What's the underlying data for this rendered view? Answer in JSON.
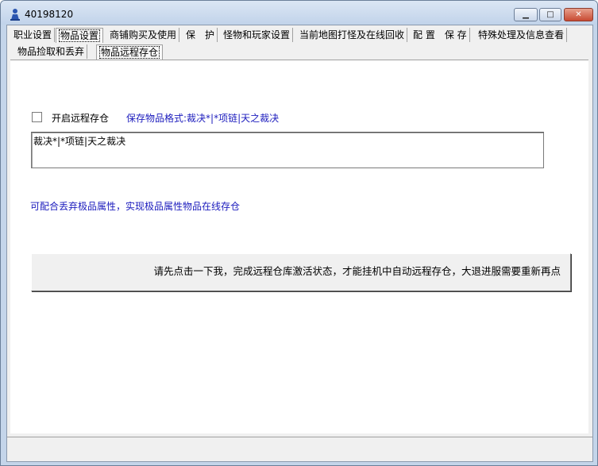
{
  "window": {
    "title": "40198120"
  },
  "tabs_main": [
    {
      "label": "职业设置"
    },
    {
      "label": "物品设置"
    },
    {
      "label": "商铺购买及使用"
    },
    {
      "label": "保　护"
    },
    {
      "label": "怪物和玩家设置"
    },
    {
      "label": "当前地图打怪及在线回收"
    },
    {
      "label": "配 置　保 存"
    },
    {
      "label": "特殊处理及信息查看"
    }
  ],
  "tabs_sub": [
    {
      "label": "物品捡取和丢弃"
    },
    {
      "label": "物品远程存仓"
    }
  ],
  "active_main_tab": "物品设置",
  "active_sub_tab": "物品远程存仓",
  "remote_storage": {
    "enable_label": "开启远程存仓",
    "enabled": false,
    "format_hint": "保存物品格式:裁决*|*项链|天之裁决",
    "items_value": "裁决*|*项链|天之裁决",
    "info_text": "可配合丢弃极品属性，实现极品属性物品在线存仓",
    "activate_button_label": "请先点击一下我，完成远程仓库激活状态，才能挂机中自动远程存仓，大退进服需要重新再点"
  },
  "colors": {
    "link_blue": "#1b1bbd",
    "titlebar": "#c4d5ea"
  },
  "icons": {
    "app": "user-figure-icon",
    "minimize": "minimize-icon",
    "maximize": "maximize-icon",
    "close": "close-icon"
  }
}
